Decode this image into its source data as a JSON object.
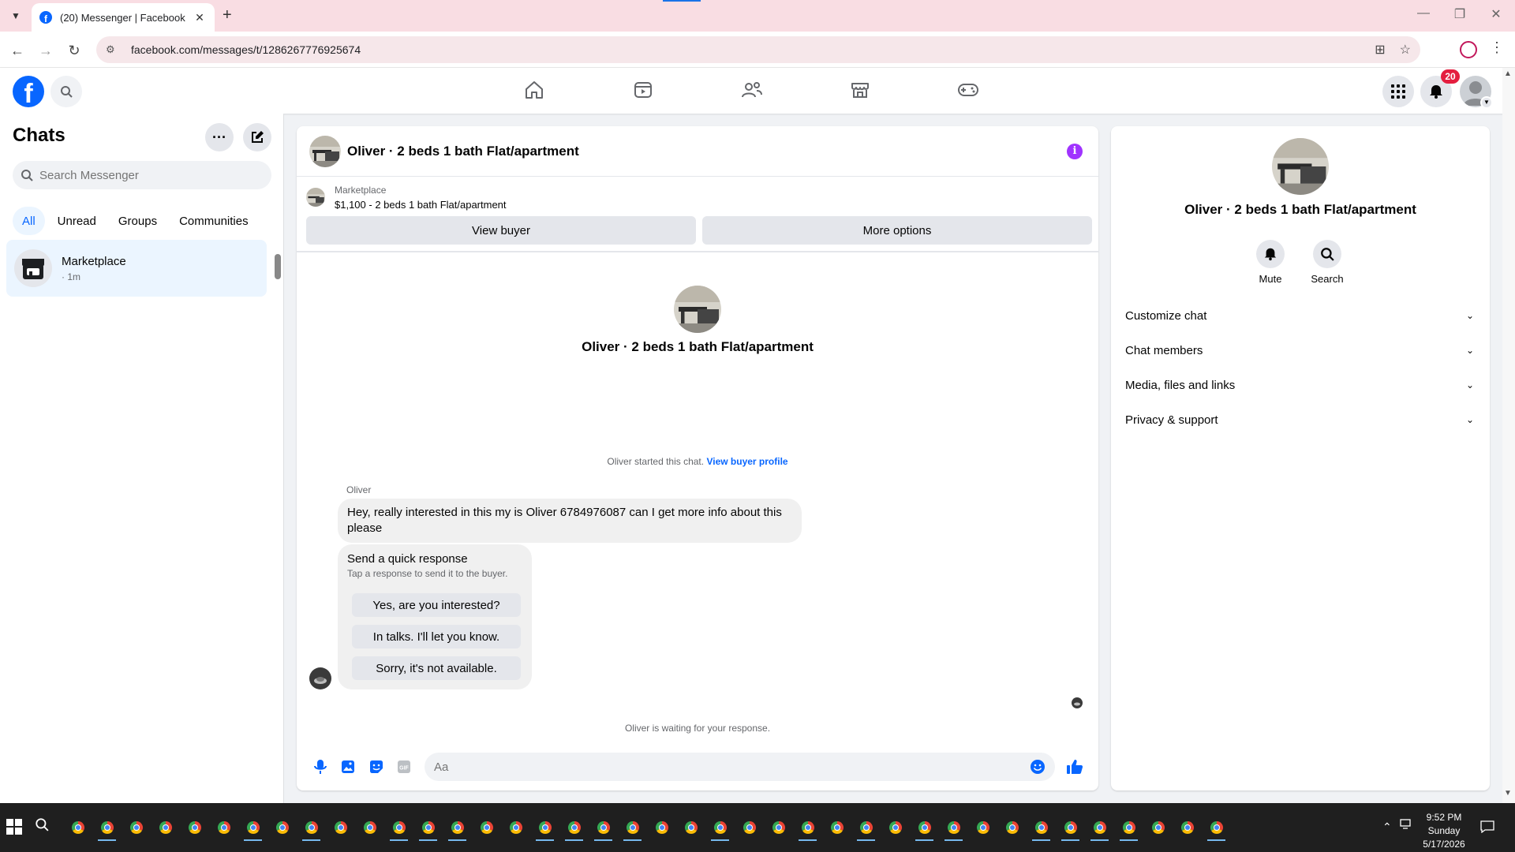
{
  "browser": {
    "tab_title": "(20) Messenger | Facebook",
    "url": "facebook.com/messages/t/1286267776925674"
  },
  "fb_header": {
    "notification_count": "20"
  },
  "sidebar": {
    "title": "Chats",
    "search_placeholder": "Search Messenger",
    "filters": [
      {
        "label": "All",
        "active": true
      },
      {
        "label": "Unread"
      },
      {
        "label": "Groups"
      },
      {
        "label": "Communities"
      }
    ],
    "chats": [
      {
        "name": "Marketplace",
        "time": "· 1m"
      }
    ]
  },
  "conversation": {
    "title": "Oliver · 2 beds 1 bath Flat/apartment",
    "marketplace": {
      "label": "Marketplace",
      "listing": "$1,100 - 2 beds 1 bath Flat/apartment",
      "view_buyer_label": "View buyer",
      "more_options_label": "More options"
    },
    "intro_name": "Oliver · 2 beds 1 bath Flat/apartment",
    "started_text": "Oliver started this chat.",
    "view_buyer_profile_label": "View buyer profile",
    "sender": "Oliver",
    "message": "Hey, really interested in this my is Oliver 6784976087 can I get more info about this please",
    "quick_response": {
      "title": "Send a quick response",
      "subtitle": "Tap a response to send it to the buyer.",
      "options": [
        "Yes, are you interested?",
        "In talks. I'll let you know.",
        "Sorry, it's not available."
      ]
    },
    "waiting_text": "Oliver is waiting for your response.",
    "composer_placeholder": "Aa"
  },
  "info_panel": {
    "name": "Oliver · 2 beds 1 bath Flat/apartment",
    "actions": [
      {
        "label": "Mute",
        "icon": "bell-icon"
      },
      {
        "label": "Search",
        "icon": "search-icon"
      }
    ],
    "sections": [
      "Customize chat",
      "Chat members",
      "Media, files and links",
      "Privacy & support"
    ]
  },
  "taskbar": {
    "time": "9:52 PM",
    "day": "Sunday",
    "date": "5/17/2026"
  },
  "colors": {
    "fb_blue": "#0866ff",
    "tab_strip": "#f9dde3",
    "info_purple": "#a033ff",
    "badge_red": "#e41e3f"
  }
}
